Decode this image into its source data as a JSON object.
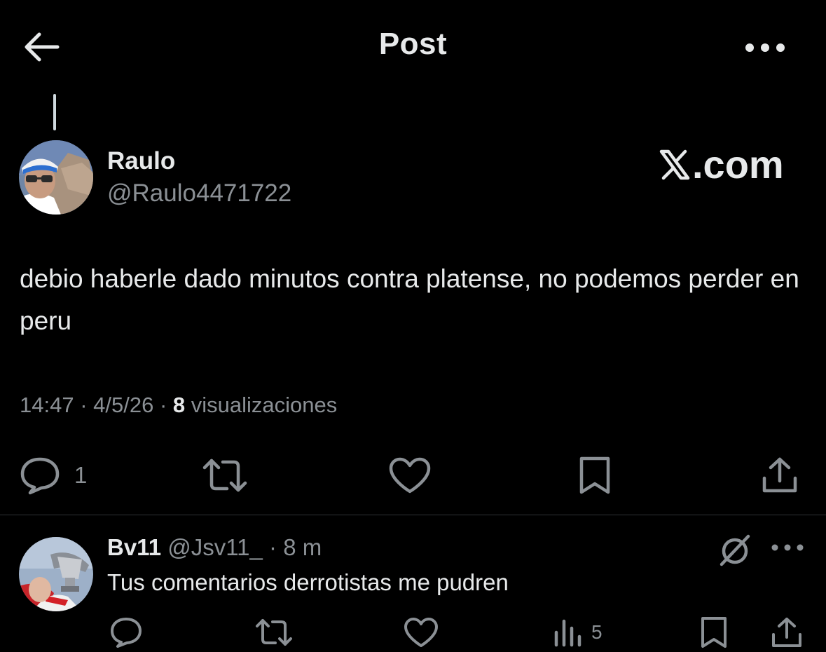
{
  "header": {
    "title": "Post",
    "back_icon": "arrow-left-icon",
    "more_icon": "more-horizontal-icon"
  },
  "post": {
    "author_name": "Raulo",
    "author_handle": "@Raulo4471722",
    "watermark": ".com",
    "text": "debio haberle dado minutos contra platense, no podemos perder en peru",
    "time": "14:47",
    "date": "4/5/26",
    "views_count": "8",
    "views_label": "visualizaciones",
    "meta_separator": " · ",
    "actions": {
      "reply_count": "1",
      "reply_icon": "reply-bubble-icon",
      "repost_icon": "repost-icon",
      "like_icon": "heart-icon",
      "bookmark_icon": "bookmark-icon",
      "share_icon": "share-icon"
    }
  },
  "reply": {
    "author_name": "Bv11",
    "author_handle": "@Jsv11_",
    "separator": " · ",
    "time": "8 m",
    "text": "Tus comentarios derrotistas me pudren",
    "views_count": "5",
    "grok_icon": "grok-slash-circle-icon",
    "more_icon": "more-horizontal-icon",
    "views_icon": "bar-chart-icon"
  },
  "colors": {
    "background": "#000000",
    "text_primary": "#e7e9ea",
    "text_secondary": "#8b9095",
    "divider": "#2f3336"
  }
}
